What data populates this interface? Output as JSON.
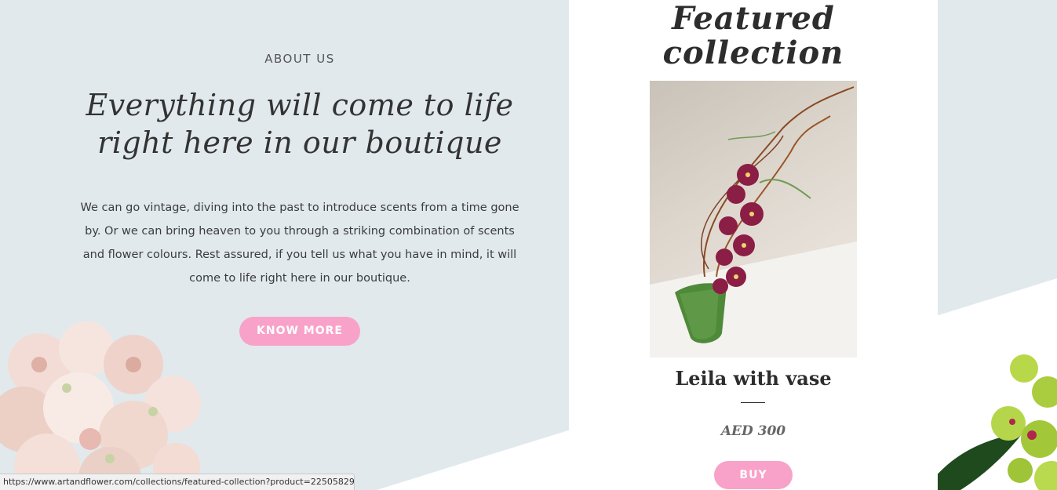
{
  "about": {
    "eyebrow": "ABOUT US",
    "headline_line1": "Everything will come to life",
    "headline_line2": "right here in our boutique",
    "body": "We can go vintage, diving into the past to introduce scents from a time gone by. Or we can bring heaven to you through a striking combination of scents and flower colours. Rest assured, if you tell us what you have in mind, it will come to life right here in our boutique.",
    "button_label": "KNOW MORE"
  },
  "featured": {
    "title_line1": "Featured",
    "title_line2": "collection",
    "product": {
      "name": "Leila with vase",
      "price": "AED 300",
      "buy_label": "BUY",
      "image_alt": "Magenta orchid arrangement with curly willow in green glass vase"
    }
  },
  "status_bar": {
    "url": "https://www.artandflower.com/collections/featured-collection?product=22505829..."
  },
  "colors": {
    "page_background": "#e1e9ed",
    "accent_pink": "#f8a2c9",
    "card_background": "#ffffff",
    "text_dark": "#333333"
  }
}
